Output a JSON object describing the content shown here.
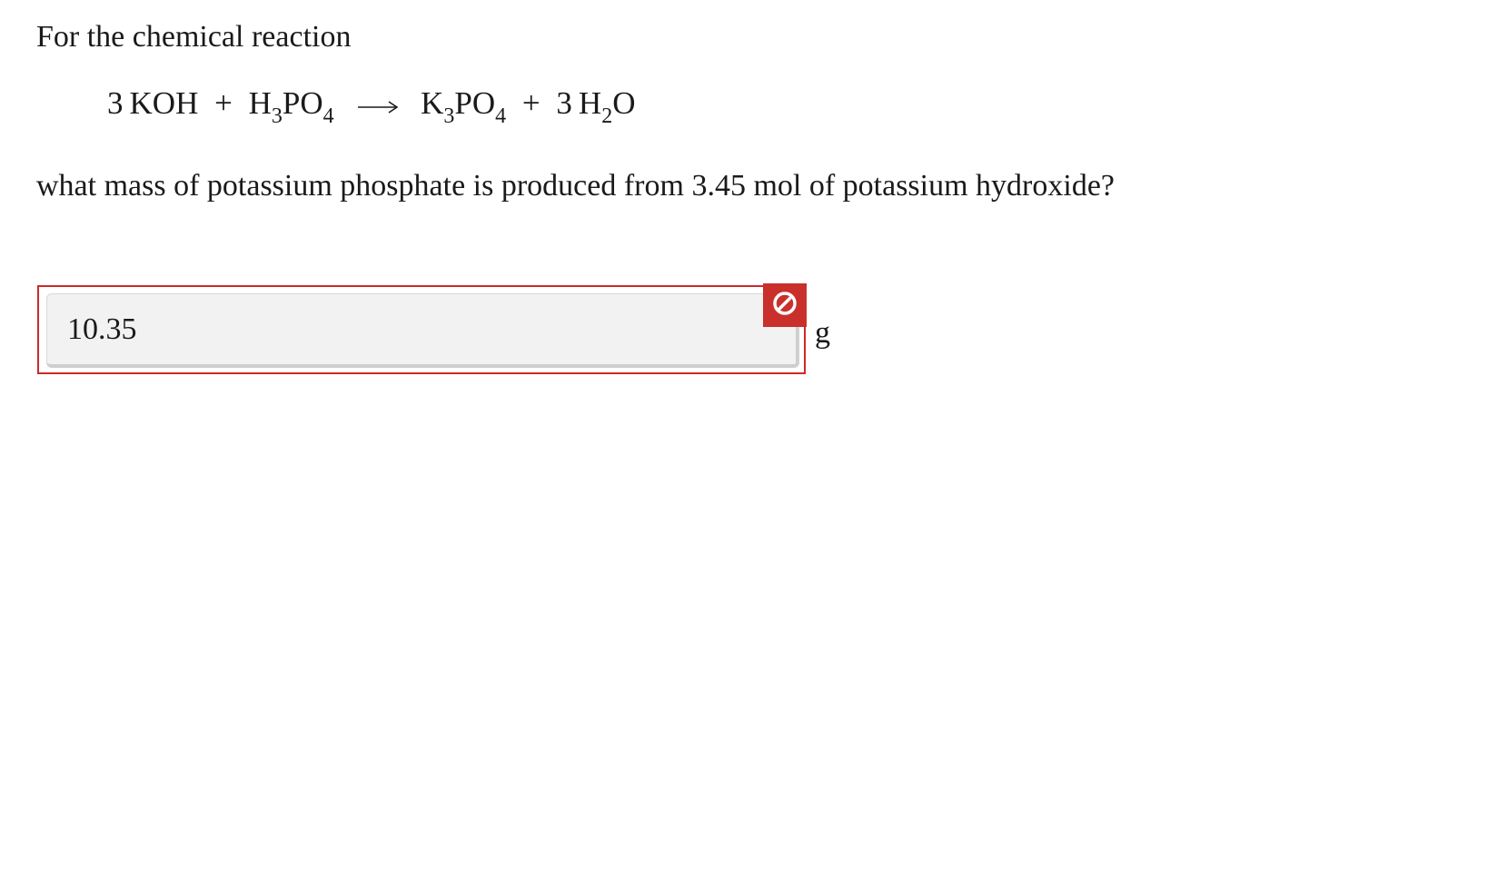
{
  "question": {
    "intro": "For the chemical reaction",
    "equation": {
      "reactant1_coef": "3",
      "reactant1": "KOH",
      "plus1": "+",
      "reactant2_h": "H",
      "reactant2_h_sub": "3",
      "reactant2_p": "PO",
      "reactant2_o_sub": "4",
      "arrow": "⟶",
      "product1_k": "K",
      "product1_k_sub": "3",
      "product1_p": "PO",
      "product1_o_sub": "4",
      "plus2": "+",
      "product2_coef": "3",
      "product2_h": "H",
      "product2_h_sub": "2",
      "product2_o": "O"
    },
    "prompt": "what mass of potassium phosphate is produced from 3.45 mol of potassium hydroxide?"
  },
  "answer": {
    "value": "10.35",
    "unit": "g",
    "status": "incorrect",
    "status_icon": "prohibited-icon",
    "status_color": "#c9302c",
    "border_color": "#cc2a2a"
  }
}
